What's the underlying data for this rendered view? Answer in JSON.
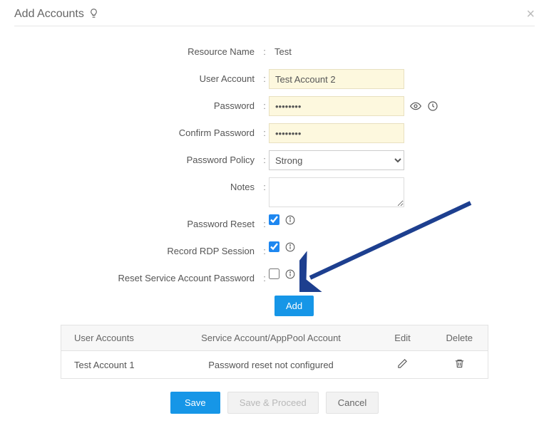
{
  "header": {
    "title": "Add Accounts"
  },
  "form": {
    "resourceName": {
      "label": "Resource Name",
      "value": "Test"
    },
    "userAccount": {
      "label": "User Account",
      "value": "Test Account 2"
    },
    "password": {
      "label": "Password",
      "value": "••••••••"
    },
    "confirm": {
      "label": "Confirm Password",
      "value": "••••••••"
    },
    "policy": {
      "label": "Password Policy",
      "selected": "Strong",
      "options": [
        "Strong"
      ]
    },
    "notes": {
      "label": "Notes",
      "value": ""
    },
    "pwdReset": {
      "label": "Password Reset",
      "checked": true
    },
    "recordRdp": {
      "label": "Record RDP Session",
      "checked": true
    },
    "resetSvc": {
      "label": "Reset Service Account Password",
      "checked": false
    }
  },
  "buttons": {
    "add": "Add",
    "save": "Save",
    "saveProceed": "Save & Proceed",
    "cancel": "Cancel"
  },
  "table": {
    "headers": {
      "userAccounts": "User Accounts",
      "svcAccount": "Service Account/AppPool Account",
      "edit": "Edit",
      "delete": "Delete"
    },
    "rows": [
      {
        "account": "Test Account 1",
        "status": "Password reset not configured"
      }
    ]
  }
}
